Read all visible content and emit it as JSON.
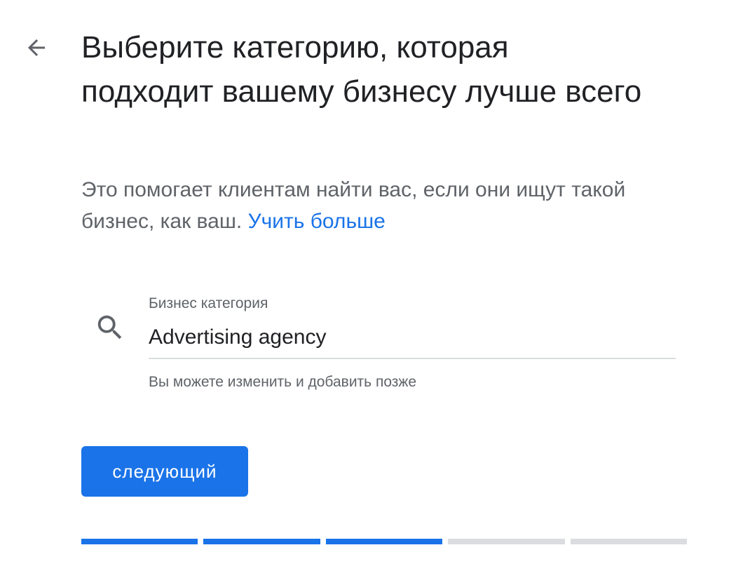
{
  "header": {
    "back_icon": "arrow-back-icon",
    "title": "Выберите категорию, которая подходит вашему бизнесу лучше всего"
  },
  "description": {
    "text": "Это помогает клиентам найти вас, если они ищут такой бизнес, как ваш.",
    "link_label": "Учить больше"
  },
  "category_field": {
    "icon": "search-icon",
    "label": "Бизнес категория",
    "value": "Advertising agency",
    "helper": "Вы можете изменить и добавить позже"
  },
  "next_button": {
    "label": "следующий"
  },
  "progress": {
    "total_steps": 5,
    "completed_steps": 3
  },
  "colors": {
    "accent": "#1a73e8",
    "text_primary": "#202124",
    "text_secondary": "#5f6368",
    "divider": "#dadce0"
  }
}
